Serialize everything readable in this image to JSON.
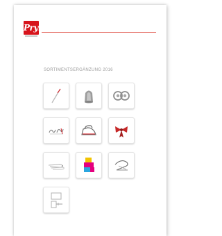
{
  "cover": {
    "brand_logo_text": "Prym",
    "title": "SORTIMENTSERGÄNZUNG 2016"
  },
  "tiles": [
    {
      "icon": "needle-icon"
    },
    {
      "icon": "thimble-icon"
    },
    {
      "icon": "snap-fasteners-icon"
    },
    {
      "icon": "hook-and-eye-icon"
    },
    {
      "icon": "iron-icon"
    },
    {
      "icon": "bow-ribbon-icon"
    },
    {
      "icon": "safety-pins-icon"
    },
    {
      "icon": "fabric-blocks-icon"
    },
    {
      "icon": "threader-icon"
    },
    {
      "icon": "measuring-gauge-icon"
    }
  ],
  "colors": {
    "brand_red": "#d7141c",
    "rule_red": "#e15a4f",
    "title_gray": "#9a9a9a"
  }
}
